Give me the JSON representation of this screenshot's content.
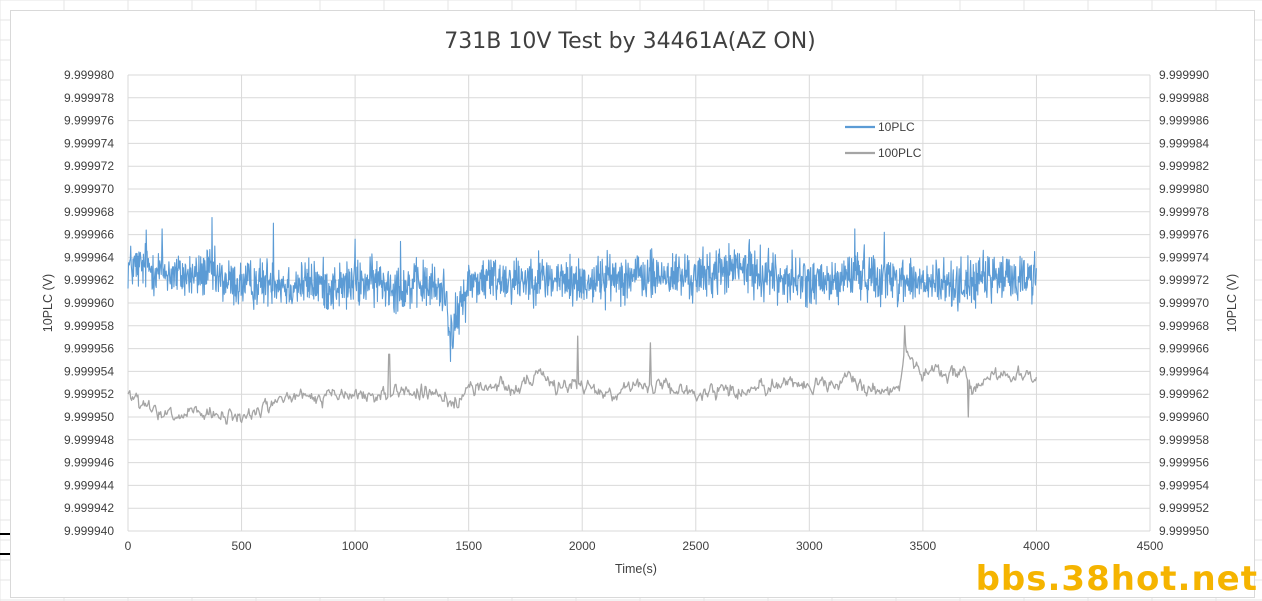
{
  "watermark": "bbs.38hot.net",
  "colors": {
    "series1": "#5b9bd5",
    "series2": "#a5a5a5",
    "grid": "#d9d9d9",
    "text": "#404040",
    "watermark": "#f5b400"
  },
  "chart_data": {
    "type": "line",
    "title": "731B 10V Test by 34461A(AZ ON)",
    "xlabel": "Time(s)",
    "ylabel": "10PLC (V)",
    "y2label": "10PLC (V)",
    "xlim": [
      0,
      4500
    ],
    "x_ticks": [
      0,
      500,
      1000,
      1500,
      2000,
      2500,
      3000,
      3500,
      4000,
      4500
    ],
    "ylim": [
      9.99994,
      9.99998
    ],
    "y_ticks": [
      "9.999940",
      "9.999942",
      "9.999944",
      "9.999946",
      "9.999948",
      "9.999950",
      "9.999952",
      "9.999954",
      "9.999956",
      "9.999958",
      "9.999960",
      "9.999962",
      "9.999964",
      "9.999966",
      "9.999968",
      "9.999970",
      "9.999972",
      "9.999974",
      "9.999976",
      "9.999978",
      "9.999980"
    ],
    "y2lim": [
      9.99995,
      9.99999
    ],
    "y2_ticks": [
      "9.999950",
      "9.999952",
      "9.999954",
      "9.999956",
      "9.999958",
      "9.999960",
      "9.999962",
      "9.999964",
      "9.999966",
      "9.999968",
      "9.999970",
      "9.999972",
      "9.999974",
      "9.999976",
      "9.999978",
      "9.999980",
      "9.999982",
      "9.999984",
      "9.999986",
      "9.999988",
      "9.999990"
    ],
    "grid": true,
    "legend": "top-right inside plot",
    "series": [
      {
        "name": "10PLC",
        "axis": "left",
        "color": "#5b9bd5",
        "x": [
          0,
          100,
          200,
          300,
          350,
          400,
          500,
          600,
          640,
          700,
          800,
          900,
          1000,
          1100,
          1200,
          1300,
          1400,
          1420,
          1500,
          1600,
          1700,
          1800,
          1900,
          2000,
          2100,
          2200,
          2300,
          2400,
          2500,
          2600,
          2700,
          2800,
          2900,
          3000,
          3100,
          3200,
          3300,
          3400,
          3500,
          3600,
          3700,
          3800,
          3900,
          4000
        ],
        "y": [
          9.9999632,
          9.9999631,
          9.9999625,
          9.9999623,
          9.9999628,
          9.999962,
          9.9999616,
          9.9999618,
          9.9999622,
          9.9999615,
          9.9999618,
          9.9999614,
          9.9999617,
          9.9999619,
          9.9999614,
          9.9999616,
          9.999961,
          9.999957,
          9.9999618,
          9.9999622,
          9.9999621,
          9.9999623,
          9.999962,
          9.9999618,
          9.9999622,
          9.9999624,
          9.9999623,
          9.9999624,
          9.9999622,
          9.9999628,
          9.9999631,
          9.9999625,
          9.9999621,
          9.9999618,
          9.9999617,
          9.9999626,
          9.9999624,
          9.9999621,
          9.9999617,
          9.9999616,
          9.9999618,
          9.9999622,
          9.9999622,
          9.9999624
        ],
        "noise": 1.5e-06,
        "spikes": [
          [
            370,
            9.9999675
          ],
          [
            640,
            9.999967
          ],
          [
            80,
            9.9999664
          ],
          [
            150,
            9.9999665
          ],
          [
            1200,
            9.9999654
          ],
          [
            1430,
            9.999956
          ],
          [
            3200,
            9.9999665
          ],
          [
            3330,
            9.9999662
          ],
          [
            1000,
            9.9999656
          ],
          [
            2820,
            9.9999648
          ]
        ]
      },
      {
        "name": "100PLC",
        "axis": "right",
        "color": "#a5a5a5",
        "x": [
          0,
          50,
          100,
          150,
          200,
          300,
          400,
          500,
          600,
          700,
          800,
          900,
          1000,
          1050,
          1100,
          1150,
          1200,
          1300,
          1400,
          1450,
          1500,
          1600,
          1700,
          1800,
          1900,
          1950,
          2000,
          2100,
          2200,
          2300,
          2400,
          2500,
          2600,
          2700,
          2800,
          2900,
          3000,
          3100,
          3200,
          3300,
          3400,
          3420,
          3500,
          3600,
          3700,
          3720,
          3800,
          3900,
          4000
        ],
        "y": [
          9.9999622,
          9.999961,
          9.9999606,
          9.99996,
          9.99996,
          9.9999603,
          9.9999599,
          9.99996,
          9.9999608,
          9.9999618,
          9.9999616,
          9.9999618,
          9.999962,
          9.9999619,
          9.9999617,
          9.9999622,
          9.9999624,
          9.999962,
          9.9999616,
          9.9999614,
          9.9999624,
          9.9999628,
          9.9999627,
          9.9999634,
          9.9999628,
          9.999963,
          9.9999626,
          9.9999622,
          9.9999625,
          9.9999628,
          9.9999622,
          9.9999621,
          9.9999625,
          9.9999622,
          9.9999628,
          9.999963,
          9.9999628,
          9.9999627,
          9.9999631,
          9.9999626,
          9.9999624,
          9.999966,
          9.999964,
          9.9999638,
          9.9999635,
          9.999962,
          9.9999638,
          9.999964,
          9.999963
        ],
        "noise": 6e-07,
        "spikes": [
          [
            1980,
            9.9999671
          ],
          [
            3420,
            9.999968
          ],
          [
            1150,
            9.9999655
          ],
          [
            2300,
            9.9999665
          ],
          [
            3700,
            9.99996
          ]
        ]
      }
    ]
  }
}
